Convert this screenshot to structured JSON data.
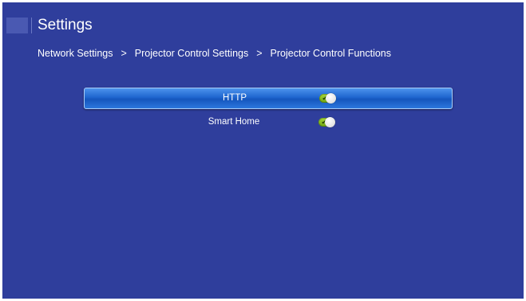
{
  "header": {
    "title": "Settings"
  },
  "breadcrumb": {
    "items": [
      "Network Settings",
      "Projector Control Settings",
      "Projector Control Functions"
    ],
    "separator": ">"
  },
  "options": [
    {
      "label": "HTTP",
      "enabled": true,
      "selected": true
    },
    {
      "label": "Smart Home",
      "enabled": true,
      "selected": false
    }
  ],
  "icons": {
    "toggle_check": "✔",
    "logo": "settings-logo-icon"
  },
  "colors": {
    "background": "#2f3e9c",
    "selection": "#1f66cf",
    "toggle_on": "#8cc12a"
  }
}
